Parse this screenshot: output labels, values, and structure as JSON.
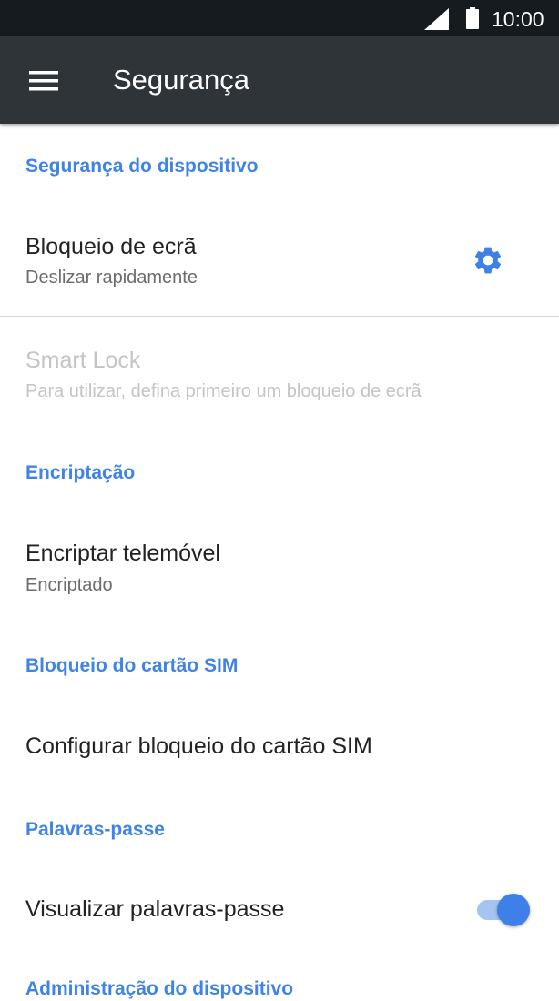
{
  "status_bar": {
    "time": "10:00",
    "icons": [
      "signal-icon",
      "battery-icon"
    ]
  },
  "toolbar": {
    "menu_icon": "menu-icon",
    "title": "Segurança"
  },
  "sections": {
    "device_security": {
      "header": "Segurança do dispositivo",
      "screen_lock": {
        "title": "Bloqueio de ecrã",
        "summary": "Deslizar rapidamente",
        "settings_icon": "gear-icon"
      },
      "smart_lock": {
        "title": "Smart Lock",
        "summary": "Para utilizar, defina primeiro um bloqueio de ecrã"
      }
    },
    "encryption": {
      "header": "Encriptação",
      "encrypt_phone": {
        "title": "Encriptar telemóvel",
        "summary": "Encriptado"
      }
    },
    "sim_lock": {
      "header": "Bloqueio do cartão SIM",
      "configure": {
        "title": "Configurar bloqueio do cartão SIM"
      }
    },
    "passwords": {
      "header": "Palavras-passe",
      "show_passwords": {
        "title": "Visualizar palavras-passe",
        "enabled": true
      }
    },
    "device_admin": {
      "header": "Administração do dispositivo"
    }
  },
  "colors": {
    "status_bar": "#161b20",
    "toolbar": "#2f3439",
    "accent": "#3f83e6",
    "toggle_thumb": "#3f7fe8",
    "toggle_track": "#a6c4f1",
    "disabled_text": "#c4c4c4"
  }
}
